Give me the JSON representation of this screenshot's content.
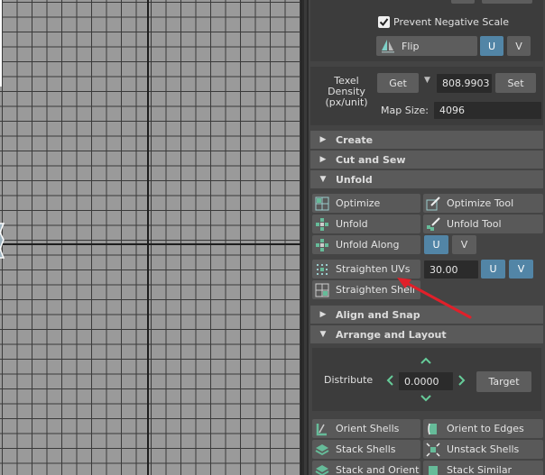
{
  "top": {
    "prevent_negative_scale": "Prevent Negative Scale",
    "flip": "Flip",
    "u": "U",
    "v": "V"
  },
  "texel": {
    "label_line1": "Texel",
    "label_line2": "Density",
    "label_line3": "(px/unit)",
    "get": "Get",
    "density_value": "808.9903",
    "set": "Set",
    "map_size_label": "Map Size:",
    "map_size_value": "4096"
  },
  "sections": {
    "create": "Create",
    "cut_and_sew": "Cut and Sew",
    "unfold": "Unfold",
    "align_and_snap": "Align and Snap",
    "arrange_and_layout": "Arrange and Layout"
  },
  "unfold_tools": {
    "optimize": "Optimize",
    "optimize_tool": "Optimize Tool",
    "unfold": "Unfold",
    "unfold_tool": "Unfold Tool",
    "unfold_along": "Unfold Along",
    "u": "U",
    "v": "V",
    "straighten_uvs": "Straighten UVs",
    "straighten_value": "30.00",
    "straighten_shell": "Straighten Shell"
  },
  "arrange": {
    "distribute": "Distribute",
    "distribute_value": "0.0000",
    "target": "Target",
    "orient_shells": "Orient Shells",
    "orient_to_edges": "Orient to Edges",
    "stack_shells": "Stack Shells",
    "unstack_shells": "Unstack Shells",
    "stack_and_orient": "Stack and Orient",
    "stack_similar": "Stack Similar"
  },
  "colors": {
    "accent_blue": "#5285a6",
    "annotation_arrow": "#e0202a"
  }
}
